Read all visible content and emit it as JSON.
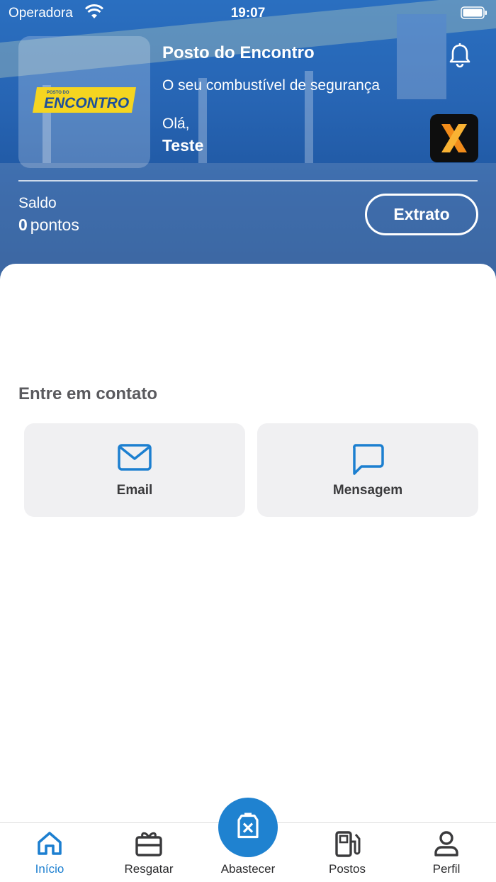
{
  "status": {
    "carrier": "Operadora",
    "time": "19:07"
  },
  "header": {
    "brand_small": "POSTO DO",
    "brand_big": "ENCONTRO",
    "station_name": "Posto do Encontro",
    "slogan": "O seu combustível de segurança",
    "greeting": "Olá,",
    "user_name": "Teste",
    "partner_logo": "X"
  },
  "balance": {
    "label": "Saldo",
    "value": "0",
    "unit": "pontos",
    "statement_button": "Extrato"
  },
  "contact": {
    "title": "Entre em contato",
    "email_label": "Email",
    "message_label": "Mensagem"
  },
  "tabs": {
    "home": "Início",
    "redeem": "Resgatar",
    "refuel": "Abastecer",
    "stations": "Postos",
    "profile": "Perfil"
  },
  "colors": {
    "primary": "#1f82d0",
    "header": "#2765b4",
    "brand_yellow": "#f5d520"
  }
}
